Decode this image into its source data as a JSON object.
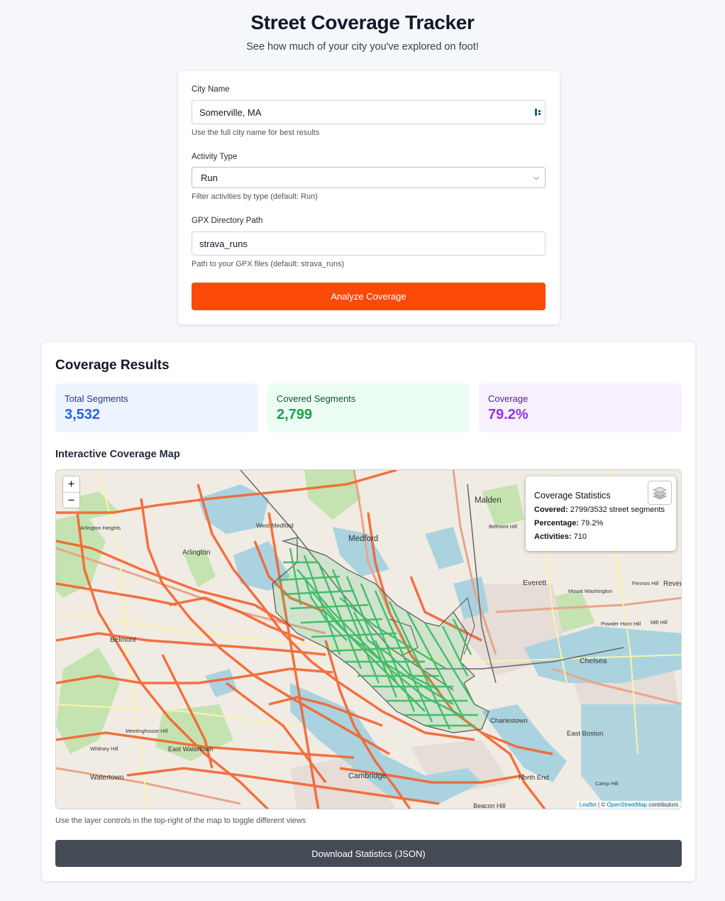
{
  "header": {
    "title": "Street Coverage Tracker",
    "subtitle": "See how much of your city you've explored on foot!"
  },
  "form": {
    "city_label": "City Name",
    "city_value": "Somerville, MA",
    "city_hint": "Use the full city name for best results",
    "activity_label": "Activity Type",
    "activity_value": "Run",
    "activity_hint": "Filter activities by type (default: Run)",
    "gpx_label": "GPX Directory Path",
    "gpx_value": "strava_runs",
    "gpx_hint": "Path to your GPX files (default: strava_runs)",
    "analyze_label": "Analyze Coverage"
  },
  "results": {
    "title": "Coverage Results",
    "stats": [
      {
        "label": "Total Segments",
        "value": "3,532",
        "color": "#2563eb",
        "bg": "#eef4ff"
      },
      {
        "label": "Covered Segments",
        "value": "2,799",
        "color": "#16a34a",
        "bg": "#ecfdf3"
      },
      {
        "label": "Coverage",
        "value": "79.2%",
        "color": "#9333ea",
        "bg": "#f7f0ff"
      }
    ],
    "map_heading": "Interactive Coverage Map",
    "map_note": "Use the layer controls in the top-right of the map to toggle different views",
    "download_label": "Download Statistics (JSON)"
  },
  "map": {
    "zoom_in": "+",
    "zoom_out": "−",
    "labels": [
      "Malden",
      "Medford",
      "West Medford",
      "Arlington",
      "Arlington Heights",
      "Everett",
      "Belmont",
      "Chelsea",
      "Charlestown",
      "East Boston",
      "East Watertown",
      "Watertown",
      "Cambridge",
      "North End",
      "Beacon Hill",
      "Revere",
      "Mount Washington",
      "Powder Horn Hill",
      "Camp Hill",
      "Meetinghouse Hill",
      "Whitney Hill",
      "Belmont Hill",
      "Fennos Hill",
      "Mill Hill"
    ],
    "route_color": "#f4632e",
    "covered_color": "#3dbb64",
    "popup": {
      "title": "Coverage Statistics",
      "covered_label": "Covered:",
      "covered_value": "2799/3532 street segments",
      "percentage_label": "Percentage:",
      "percentage_value": "79.2%",
      "activities_label": "Activities:",
      "activities_value": "710"
    },
    "attribution": {
      "leaflet": "Leaflet",
      "separator": "| ©",
      "osm": "OpenStreetMap",
      "contributors": "contributors"
    }
  }
}
